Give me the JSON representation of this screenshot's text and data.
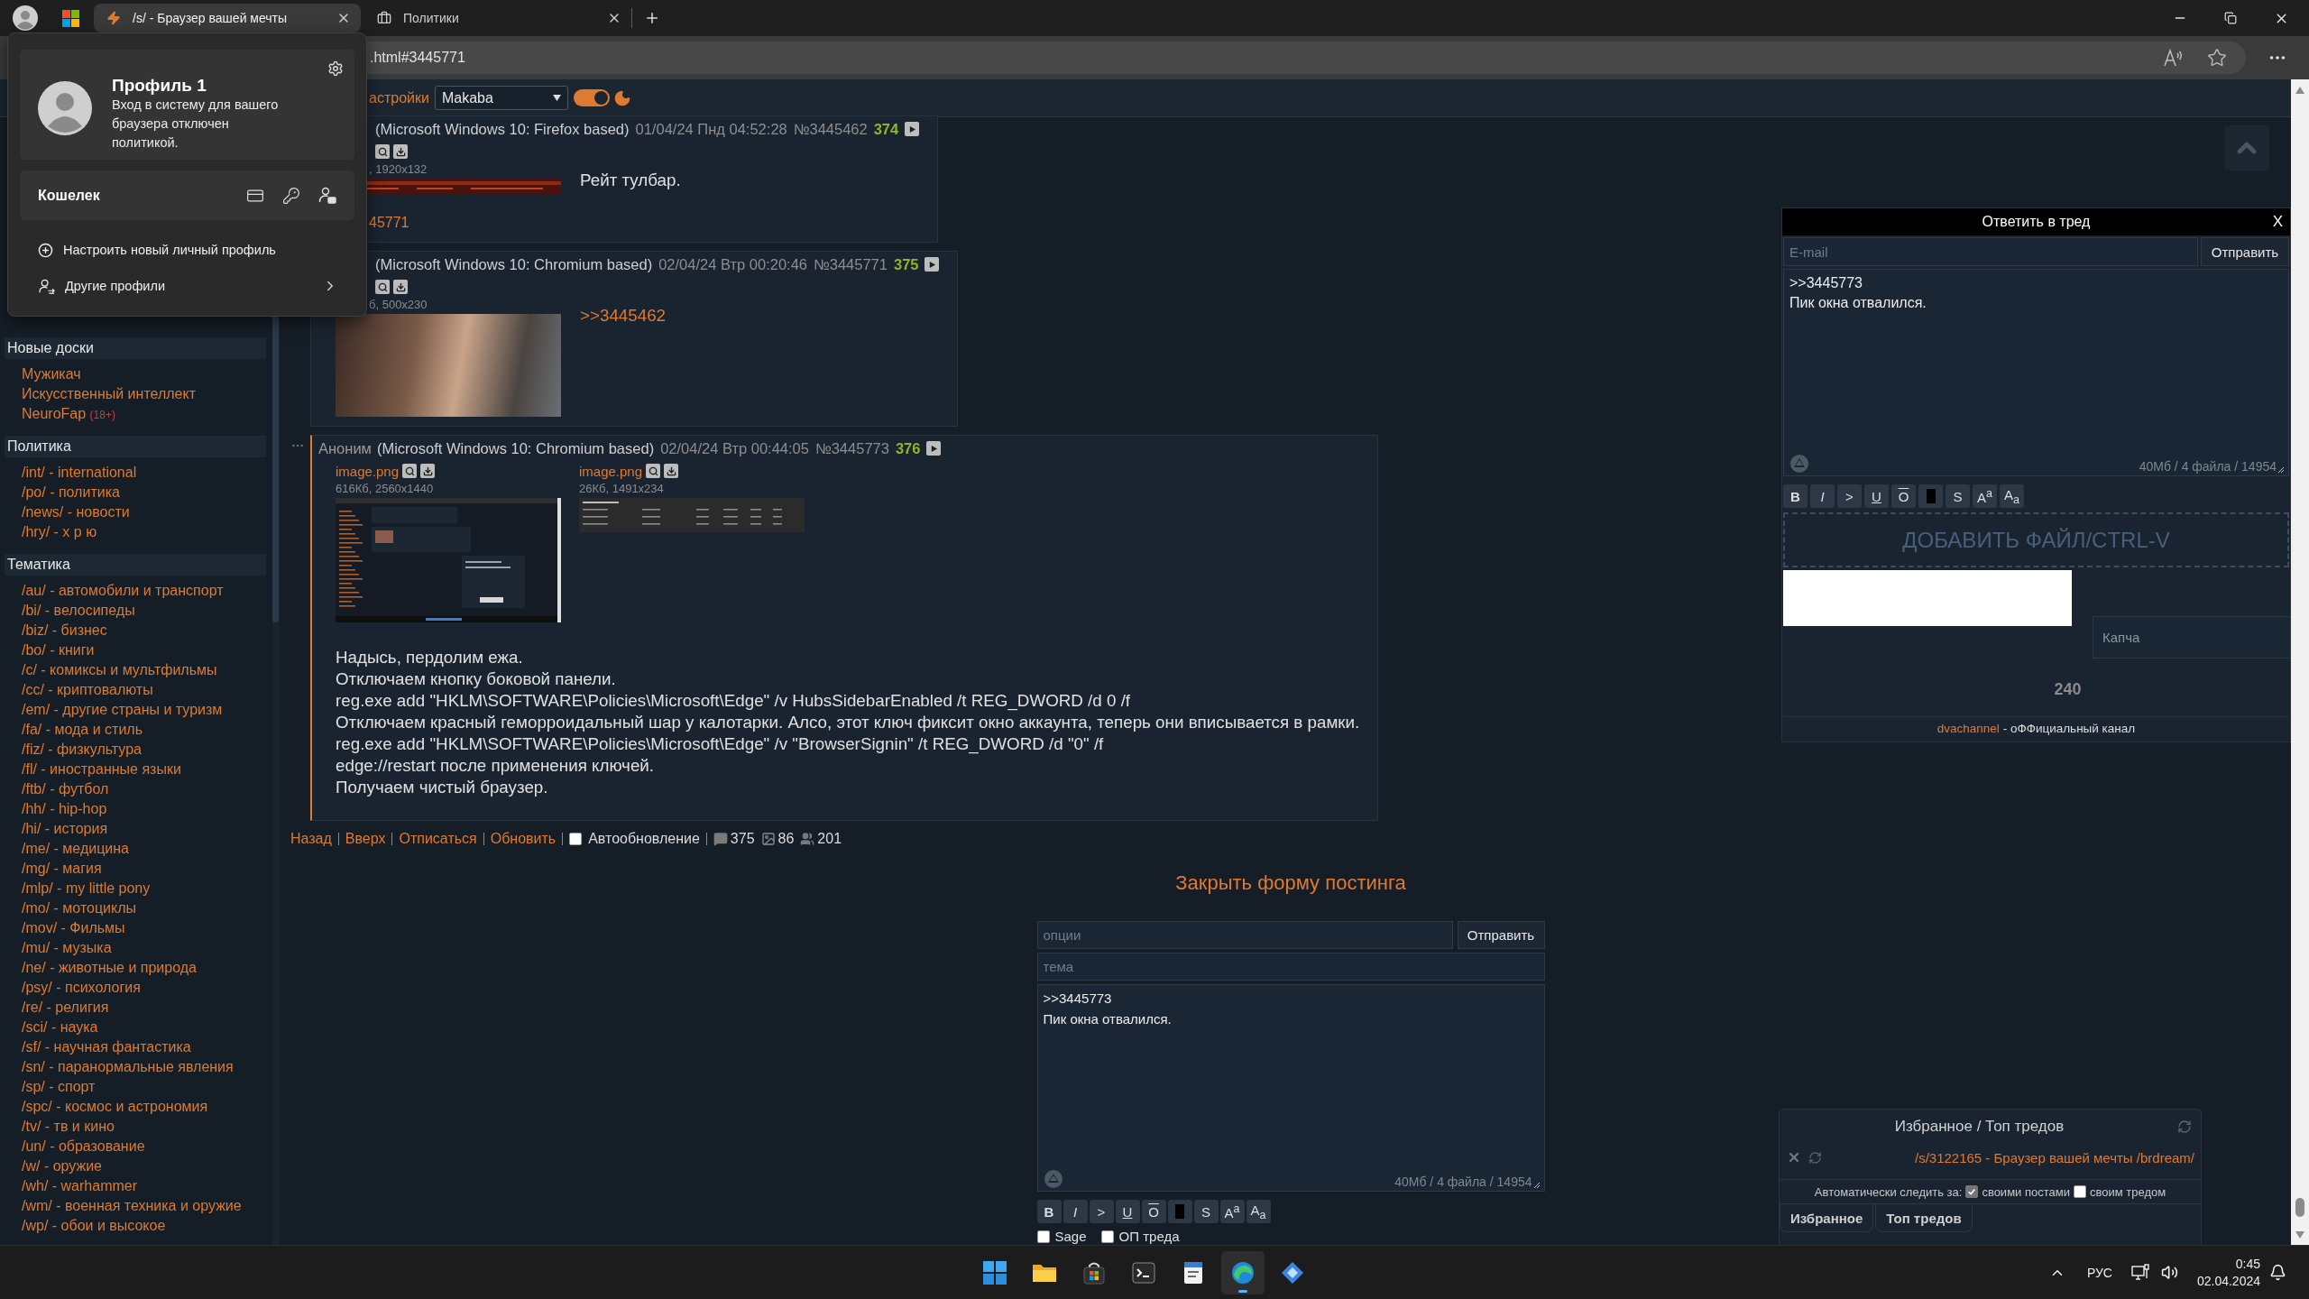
{
  "browser": {
    "tabs": [
      {
        "kind": "site",
        "title": "/s/ - Браузер вашей мечты",
        "selected": true
      },
      {
        "kind": "document",
        "title": "Политики",
        "selected": false
      }
    ],
    "address": ".html#3445771"
  },
  "profile_menu": {
    "name": "Профиль 1",
    "note": "Вход в систему для вашего браузера отключен политикой.",
    "wallet": "Кошелек",
    "actions": [
      {
        "kind": "add",
        "label": "Настроить новый личный профиль"
      },
      {
        "kind": "switch",
        "label": "Другие профили"
      }
    ]
  },
  "site_bar": {
    "settings_link": "астройки",
    "style_select": "Makaba",
    "night_mode": true
  },
  "sidebar": {
    "sections": [
      {
        "title": "Новые доски",
        "items": [
          {
            "label": "Мужикач"
          },
          {
            "label": "Искусственный интеллект"
          },
          {
            "label": "NeuroFap",
            "badge": "(18+)"
          }
        ]
      },
      {
        "title": "Политика",
        "items": [
          {
            "label": "/int/ - international"
          },
          {
            "label": "/po/ - политика"
          },
          {
            "label": "/news/ - новости"
          },
          {
            "label": "/hry/ - х р ю"
          }
        ]
      },
      {
        "title": "Тематика",
        "items": [
          {
            "label": "/au/ - автомобили и транспорт"
          },
          {
            "label": "/bi/ - велосипеды"
          },
          {
            "label": "/biz/ - бизнес"
          },
          {
            "label": "/bo/ - книги"
          },
          {
            "label": "/c/ - комиксы и мультфильмы"
          },
          {
            "label": "/cc/ - криптовалюты"
          },
          {
            "label": "/em/ - другие страны и туризм"
          },
          {
            "label": "/fa/ - мода и стиль"
          },
          {
            "label": "/fiz/ - физкультура"
          },
          {
            "label": "/fl/ - иностранные языки"
          },
          {
            "label": "/ftb/ - футбол"
          },
          {
            "label": "/hh/ - hip-hop"
          },
          {
            "label": "/hi/ - история"
          },
          {
            "label": "/me/ - медицина"
          },
          {
            "label": "/mg/ - магия"
          },
          {
            "label": "/mlp/ - my little pony"
          },
          {
            "label": "/mo/ - мотоциклы"
          },
          {
            "label": "/mov/ - Фильмы"
          },
          {
            "label": "/mu/ - музыка"
          },
          {
            "label": "/ne/ - животные и природа"
          },
          {
            "label": "/psy/ - психология"
          },
          {
            "label": "/re/ - религия"
          },
          {
            "label": "/sci/ - наука"
          },
          {
            "label": "/sf/ - научная фантастика"
          },
          {
            "label": "/sn/ - паранормальные явления"
          },
          {
            "label": "/sp/ - спорт"
          },
          {
            "label": "/spc/ - космос и астрономия"
          },
          {
            "label": "/tv/ - тв и кино"
          },
          {
            "label": "/un/ - образование"
          },
          {
            "label": "/w/ - оружие"
          },
          {
            "label": "/wh/ - warhammer"
          },
          {
            "label": "/wm/ - военная техника и оружие"
          },
          {
            "label": "/wp/ - обои и высокое"
          }
        ]
      }
    ]
  },
  "posts": [
    {
      "client": "(Microsoft Windows 10: Firefox based)",
      "date": "01/04/24 Пнд 04:52:28",
      "number": "№3445462",
      "index": "374",
      "files": [
        {
          "kind": "toolbar-strip",
          "info": ", 1920x132"
        }
      ],
      "body": [
        {
          "kind": "text",
          "text": "Рейт тулбар."
        }
      ],
      "replies": "45771"
    },
    {
      "client": "(Microsoft Windows 10: Chromium based)",
      "date": "02/04/24 Втр 00:20:46",
      "number": "№3445771",
      "index": "375",
      "own_post": false,
      "files": [
        {
          "kind": "photo",
          "info": "б, 500x230"
        }
      ],
      "body": [
        {
          "kind": "link",
          "text": ">>3445462"
        }
      ]
    },
    {
      "author": "Аноним",
      "client": "(Microsoft Windows 10: Chromium based)",
      "date": "02/04/24 Втр 00:44:05",
      "number": "№3445773",
      "index": "376",
      "own_post": true,
      "menu": true,
      "files": [
        {
          "kind": "screenshot",
          "name": "image.png",
          "info": "616Кб, 2560x1440"
        },
        {
          "kind": "table-screenshot",
          "name": "image.png",
          "info": "26Кб, 1491x234"
        }
      ],
      "body": [
        {
          "kind": "text",
          "text": "Надысь, пердолим ежа."
        },
        {
          "kind": "text",
          "text": "Отключаем кнопку боковой панели."
        },
        {
          "kind": "text",
          "text": "reg.exe add \"HKLM\\SOFTWARE\\Policies\\Microsoft\\Edge\" /v HubsSidebarEnabled /t REG_DWORD /d 0 /f"
        },
        {
          "kind": "text",
          "text": "Отключаем красный геморроидальный шар у калотарки. Алсо, этот ключ фиксит окно аккаунта, теперь они вписывается в рамки."
        },
        {
          "kind": "text",
          "text": "reg.exe add \"HKLM\\SOFTWARE\\Policies\\Microsoft\\Edge\" /v \"BrowserSignin\" /t REG_DWORD /d \"0\" /f"
        },
        {
          "kind": "text",
          "text": "edge://restart после применения ключей."
        },
        {
          "kind": "text",
          "text": "Получаем чистый браузер."
        }
      ]
    }
  ],
  "thread_nav": {
    "links": [
      "Назад",
      "Вверх",
      "Отписаться",
      "Обновить"
    ],
    "auto_update": {
      "label": "Автообновление",
      "checked": false
    },
    "stats": [
      {
        "kind": "posts",
        "value": "375"
      },
      {
        "kind": "images",
        "value": "86"
      },
      {
        "kind": "posters",
        "value": "201"
      }
    ]
  },
  "close_form_link": "Закрыть форму постинга",
  "bottom_form": {
    "options": {
      "placeholder": "опции"
    },
    "submit": "Отправить",
    "subject": {
      "placeholder": "тема"
    },
    "message": [
      ">>3445773",
      "Пик окна отвалился."
    ],
    "limits": "40Мб / 4 файла / 14954",
    "markup": [
      {
        "kind": "bold",
        "label": "B"
      },
      {
        "kind": "italic",
        "label": "I"
      },
      {
        "kind": "quote",
        "label": ">"
      },
      {
        "kind": "underline",
        "label": "U"
      },
      {
        "kind": "overline",
        "label": "O"
      },
      {
        "kind": "spoiler"
      },
      {
        "kind": "strike",
        "label": "S"
      },
      {
        "kind": "sup",
        "label": "A$^{a}$"
      },
      {
        "kind": "sub",
        "label": "A$_{a}$"
      }
    ],
    "flags": [
      {
        "label": "Sage",
        "checked": false
      },
      {
        "label": "ОП треда",
        "checked": false
      }
    ]
  },
  "reply_window": {
    "title": "Ответить в тред",
    "close": "X",
    "email": {
      "placeholder": "E-mail"
    },
    "submit": "Отправить",
    "message": [
      ">>3445773",
      "Пик окна отвалился."
    ],
    "limits": "40Мб / 4 файла / 14954",
    "markup": [
      {
        "kind": "bold",
        "label": "B"
      },
      {
        "kind": "italic",
        "label": "I"
      },
      {
        "kind": "quote",
        "label": ">"
      },
      {
        "kind": "underline",
        "label": "U"
      },
      {
        "kind": "overline",
        "label": "O"
      },
      {
        "kind": "spoiler"
      },
      {
        "kind": "strike",
        "label": "S"
      },
      {
        "kind": "sup",
        "label": "A$^{a}$"
      },
      {
        "kind": "sub",
        "label": "A$_{a}$"
      }
    ],
    "file_drop": "ДОБАВИТЬ ФАЙЛ/CTRL-V",
    "captcha": {
      "placeholder": "Капча"
    },
    "timer": "240",
    "footer": {
      "link": "dvachannel",
      "text": "- оФФициальный канал"
    }
  },
  "favorites": {
    "title": "Избранное / Топ тредов",
    "threads": [
      {
        "title": "/s/3122165 - Браузер вашей мечты /brdream/"
      }
    ],
    "auto_watch": {
      "label": "Автоматически следить за:",
      "options": [
        {
          "label": "своими постами",
          "checked": true
        },
        {
          "label": "своим тредом",
          "checked": false
        }
      ]
    },
    "tabs": [
      {
        "label": "Избранное",
        "selected": false
      },
      {
        "label": "Топ тредов",
        "selected": false
      }
    ]
  },
  "taskbar": {
    "apps": [
      {
        "kind": "start",
        "active": false
      },
      {
        "kind": "files",
        "active": false
      },
      {
        "kind": "store",
        "active": false
      },
      {
        "kind": "terminal",
        "active": false
      },
      {
        "kind": "notes",
        "active": false
      },
      {
        "kind": "browser",
        "active": true
      },
      {
        "kind": "tool",
        "active": false
      }
    ],
    "tray": {
      "language": "РУС",
      "time": "0:45",
      "date": "02.04.2024"
    }
  }
}
